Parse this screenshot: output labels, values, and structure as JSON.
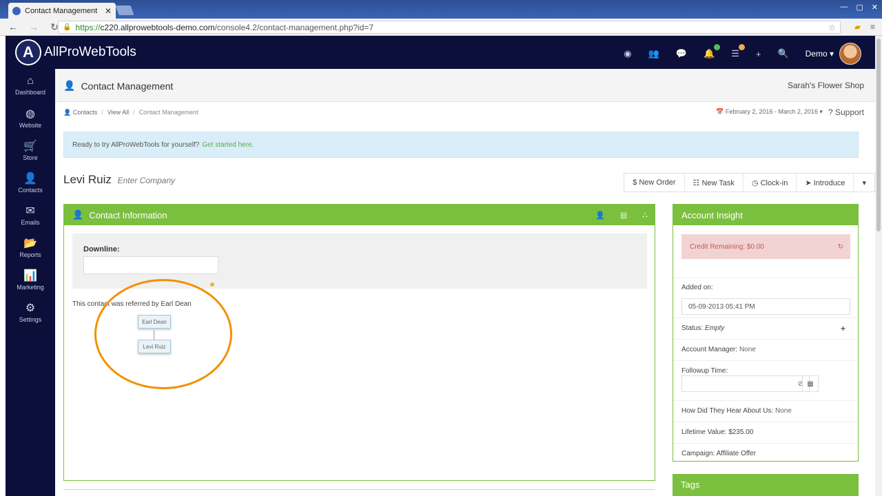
{
  "browser": {
    "tab_title": "Contact Management",
    "tab_close": "✕",
    "url_prefix": "https://",
    "url_host": "c220.allprowebtools-demo.com",
    "url_path": "/console4.2/contact-management.php?id=7",
    "window_controls": [
      "—",
      "▢",
      "✕"
    ]
  },
  "app": {
    "logo_letter": "A",
    "logo_text": "AllProWebTools",
    "user_name": "Demo ▾",
    "colors": {
      "nav_bg": "#0b0f3a",
      "accent_green": "#7bbf3f",
      "alert_blue": "#d9eef8",
      "highlight_orange": "#f29100"
    }
  },
  "topnav": {
    "icons": [
      "eye-icon",
      "users-icon",
      "chat-icon",
      "bell-icon",
      "tasks-icon",
      "plus-icon",
      "search-icon"
    ],
    "glyphs": [
      "◉",
      "👥",
      "💬",
      "🔔",
      "☰",
      "+",
      "🔍"
    ]
  },
  "sidebar": {
    "items": [
      {
        "label": "Dashboard",
        "glyph": "⌂"
      },
      {
        "label": "Website",
        "glyph": "◍"
      },
      {
        "label": "Store",
        "glyph": "🛒"
      },
      {
        "label": "Contacts",
        "glyph": "👤"
      },
      {
        "label": "Emails",
        "glyph": "✉"
      },
      {
        "label": "Reports",
        "glyph": "📂"
      },
      {
        "label": "Marketing",
        "glyph": "📊"
      },
      {
        "label": "Settings",
        "glyph": "⚙"
      }
    ]
  },
  "page": {
    "title": "Contact Management",
    "shop_name": "Sarah's Flower Shop",
    "breadcrumbs": [
      "Contacts",
      "View All",
      "Contact Management"
    ],
    "date_range": "February 2, 2016 - March 2, 2016 ▾",
    "support": "Support"
  },
  "alert": {
    "text": "Ready to try AllProWebTools for yourself?",
    "link": "Get started here."
  },
  "contact": {
    "name": "Levi Ruiz",
    "company_placeholder": "Enter Company"
  },
  "actions": [
    "$ New Order",
    "☷ New Task",
    "◷ Clock-in",
    "➤ Introduce",
    "▾"
  ],
  "contact_panel": {
    "title": "Contact Information",
    "downline_label": "Downline:",
    "referred_text": "This contact was referred by Earl Dean",
    "tree": {
      "parent": "Earl Dean",
      "child": "Levi Ruiz"
    }
  },
  "insight": {
    "title": "Account Insight",
    "credit": "Credit Remaining: $0.00",
    "added_label": "Added on:",
    "added_value": "05-09-2013 05:41 PM",
    "status_label": "Status:",
    "status_value": "Empty",
    "account_manager_label": "Account Manager:",
    "account_manager_value": "None",
    "followup_label": "Followup Time:",
    "hear_label": "How Did They Hear About Us:",
    "hear_value": "None",
    "lifetime_label": "Lifetime Value:",
    "lifetime_value": "$235.00",
    "campaign_label": "Campaign:",
    "campaign_value": "Affiliate Offer"
  },
  "tags": {
    "title": "Tags"
  }
}
